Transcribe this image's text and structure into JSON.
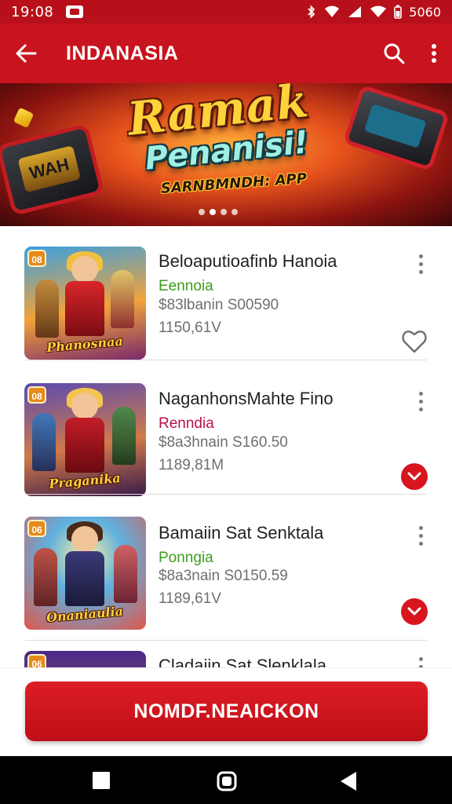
{
  "status_bar": {
    "time": "19:08",
    "battery_text": "5060"
  },
  "app_bar": {
    "title": "INDANASIA"
  },
  "banner": {
    "title_line1": "Ramak",
    "title_line2": "Penanisi!",
    "subtitle": "SARNBMNDH: APP",
    "device_screen_text": "WAH",
    "slides": 4,
    "active_slide": 2
  },
  "items": [
    {
      "badge": "08",
      "logo_text": "Phanosnaa",
      "title": "Beloaputioafinb Hanoia",
      "category": "Eennoia",
      "category_color": "#3f9a1c",
      "price": "$83lbanin S00590",
      "size": "1150,61V",
      "action": "heart-outline-icon"
    },
    {
      "badge": "08",
      "logo_text": "Praganika",
      "title": "NaganhonsMahte Fino",
      "category": "Renndia",
      "category_color": "#b5124c",
      "price": "$8a3hnain S160.50",
      "size": "1189,81M",
      "action": "chevron-down-circle-icon"
    },
    {
      "badge": "06",
      "logo_text": "Onaniaulia",
      "title": "Bamaiin Sat Senktala",
      "category": "Ponngia",
      "category_color": "#3f9a1c",
      "price": "$8a3nain S0150.59",
      "size": "1189,61V",
      "action": "chevron-down-circle-icon"
    },
    {
      "badge": "06",
      "title": "Cladaiin Sat Slenklala"
    }
  ],
  "cta": {
    "label": "NOMDF.NEAICKON"
  }
}
